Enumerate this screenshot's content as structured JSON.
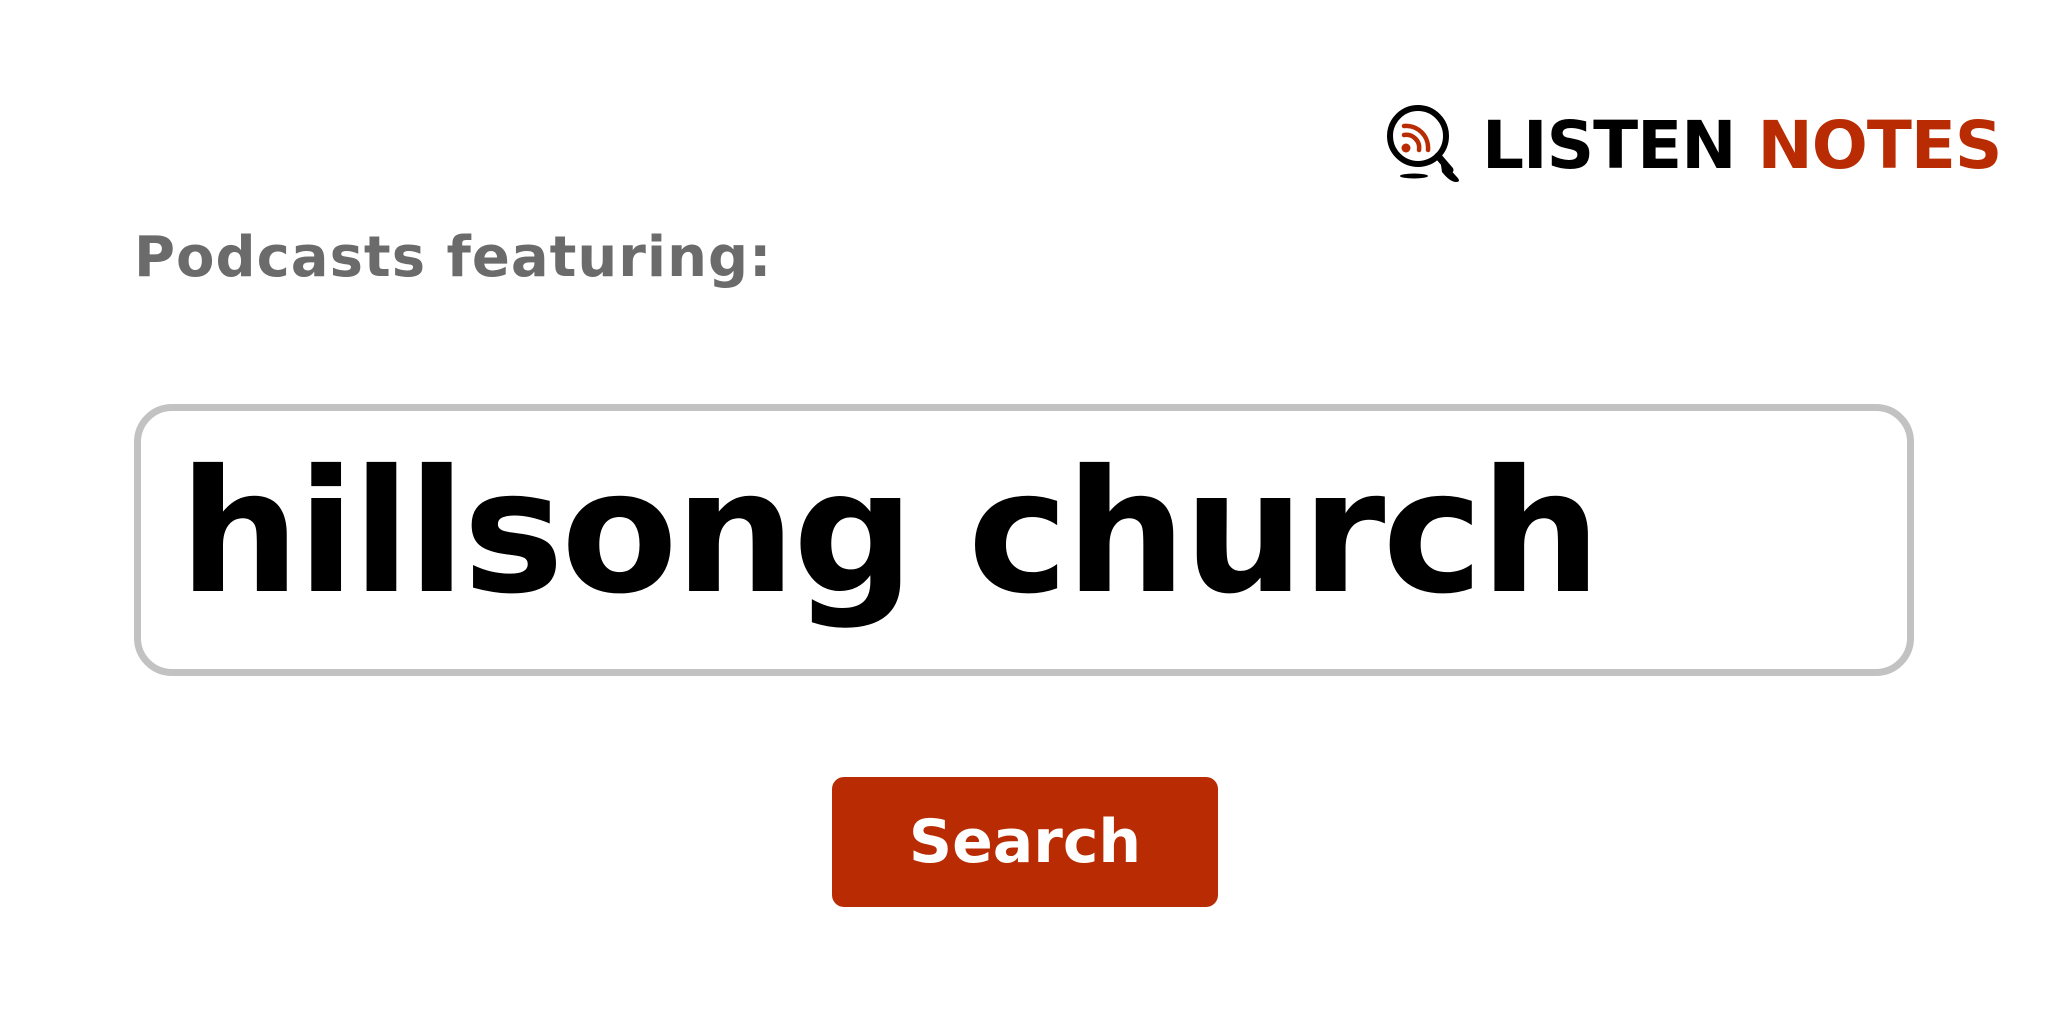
{
  "brand": {
    "name_part_1": "LISTEN",
    "name_part_2": "NOTES",
    "icon": "magnifier-rss-icon",
    "colors": {
      "primary": "#b92c03",
      "dark": "#000000"
    }
  },
  "heading": {
    "text": "Podcasts featuring:",
    "color": "#6b6b6b"
  },
  "search": {
    "value": "hillsong church",
    "border_color": "#c2c2c2"
  },
  "search_button": {
    "label": "Search",
    "background": "#b92c03",
    "text_color": "#ffffff"
  }
}
